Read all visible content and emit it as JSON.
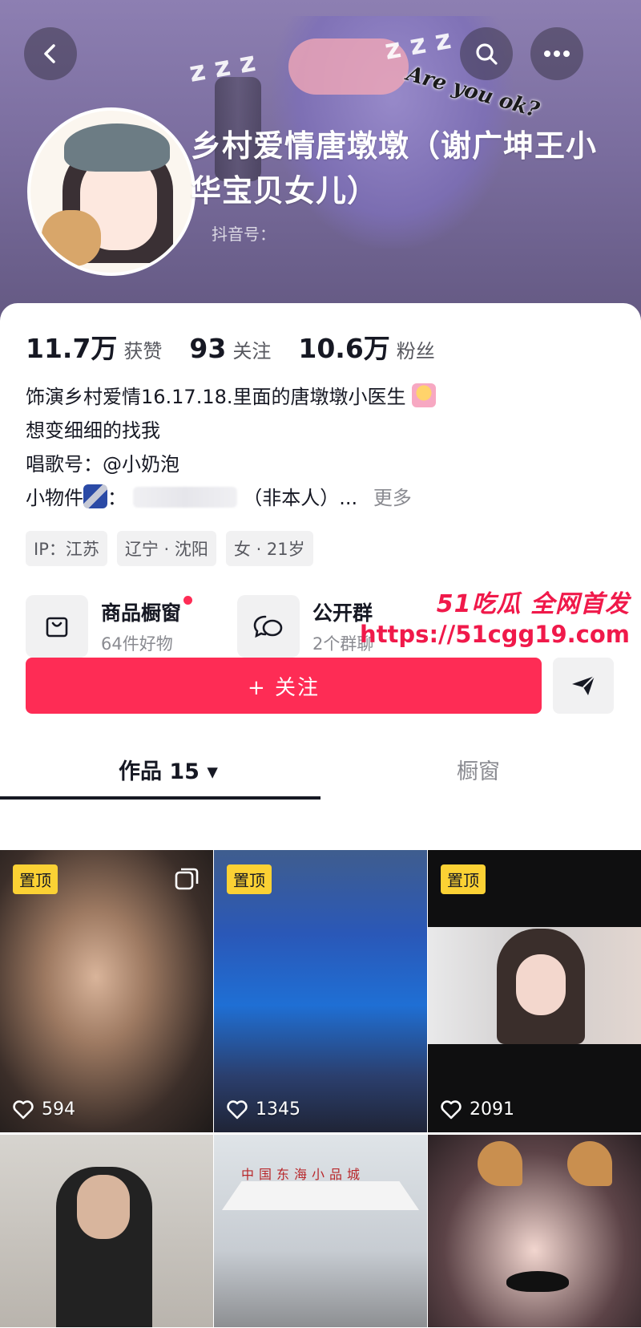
{
  "header": {
    "back_icon": "back-icon",
    "search_icon": "search-icon",
    "more_icon": "more-icon",
    "banner_text": "Are you ok?",
    "banner_zzz": "z z z"
  },
  "profile": {
    "nickname": "乡村爱情唐墩墩（谢广坤王小华宝贝女儿）",
    "douyin_id_label": "抖音号："
  },
  "stats": [
    {
      "num": "11.7万",
      "label": "获赞"
    },
    {
      "num": "93",
      "label": "关注"
    },
    {
      "num": "10.6万",
      "label": "粉丝"
    }
  ],
  "bio": {
    "line1": "饰演乡村爱情16.17.18.里面的唐墩墩小医生",
    "line2": "想变细细的找我",
    "line3": "唱歌号：@小奶泡",
    "line4_prefix": "小物件",
    "line4_colon": "：",
    "line4_suffix": "（非本人）...",
    "more": "更多"
  },
  "tags": [
    "IP：江苏",
    "辽宁 · 沈阳",
    "女 · 21岁"
  ],
  "shop": {
    "title": "商品橱窗",
    "subtitle": "64件好物",
    "icon": "shopping-bag-icon"
  },
  "group": {
    "title": "公开群",
    "subtitle": "2个群聊",
    "icon": "chat-bubbles-icon"
  },
  "actions": {
    "follow": "+ 关注",
    "share_icon": "send-icon"
  },
  "tabs": {
    "works": "作品 15 ▾",
    "window": "橱窗"
  },
  "watermark": {
    "line1": "51吃瓜 全网首发",
    "line2": "https://51cgg19.com"
  },
  "videos": [
    {
      "pinned": "置顶",
      "likes": "594",
      "multi": true
    },
    {
      "pinned": "置顶",
      "likes": "1345"
    },
    {
      "pinned": "置顶",
      "likes": "2091"
    },
    {},
    {
      "sign": "中国东海小品城"
    },
    {}
  ],
  "colors": {
    "accent": "#fe2c55",
    "pin": "#fbd134",
    "banner": "#7a6d9e"
  }
}
